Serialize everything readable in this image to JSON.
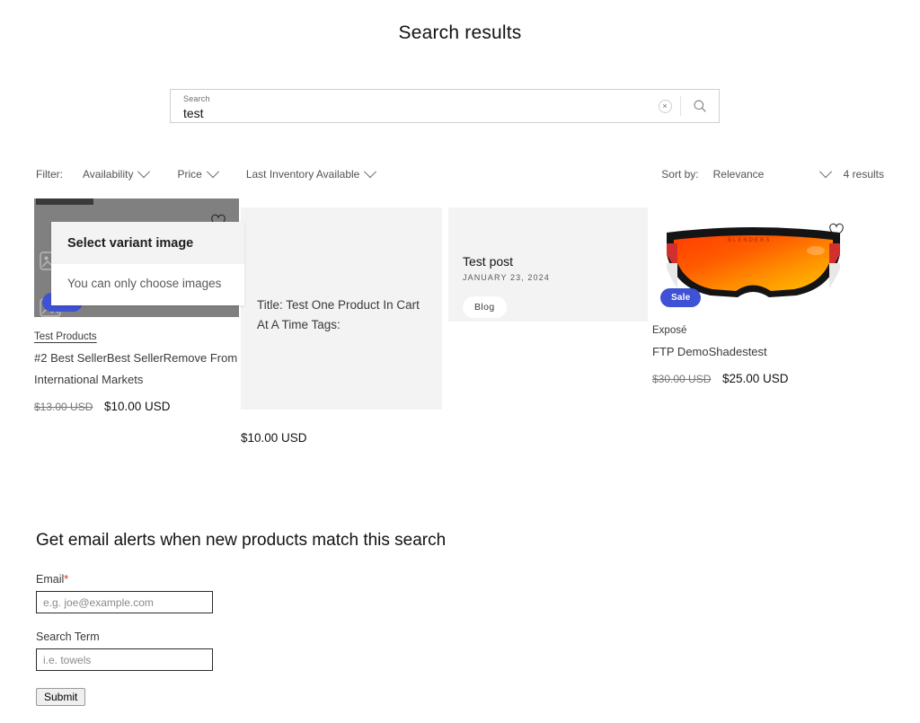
{
  "page": {
    "title": "Search results"
  },
  "search": {
    "label": "Search",
    "value": "test",
    "clear_icon": "close-circle-icon",
    "submit_icon": "search-icon"
  },
  "facets": {
    "legend": "Filter:",
    "filters": [
      {
        "label": "Availability"
      },
      {
        "label": "Price"
      },
      {
        "label": "Last Inventory Available"
      }
    ],
    "sort_legend": "Sort by:",
    "sort_value": "Relevance",
    "results_count": "4 results"
  },
  "variant_modal": {
    "title": "Select variant image",
    "body": "You can only choose images"
  },
  "results": [
    {
      "type": "product",
      "badge": "Sale",
      "vendor": "Test Products",
      "title": "#2 Best SellerBest SellerRemove From International Markets",
      "price_old": "$13.00 USD",
      "price_new": "$10.00 USD",
      "wishlist_icon": "heart-icon"
    },
    {
      "type": "product",
      "placeholder_title": "Title: Test One Product In Cart At A Time Tags:",
      "price_new": "$10.00 USD"
    },
    {
      "type": "article",
      "title": "Test post",
      "date": "JANUARY 23, 2024",
      "tag": "Blog"
    },
    {
      "type": "product",
      "badge": "Sale",
      "vendor": "Exposé",
      "title": "FTP DemoShadestest",
      "price_old": "$30.00 USD",
      "price_new": "$25.00 USD",
      "wishlist_icon": "heart-icon"
    }
  ],
  "alert_form": {
    "heading": "Get email alerts when new products match this search",
    "email_label": "Email",
    "email_required_mark": "*",
    "email_placeholder": "e.g. joe@example.com",
    "term_label": "Search Term",
    "term_placeholder": "i.e. towels",
    "submit_label": "Submit"
  },
  "colors": {
    "sale_badge": "#3f51d4",
    "required": "#d82c0d",
    "placeholder_bg": "#f3f3f3"
  }
}
